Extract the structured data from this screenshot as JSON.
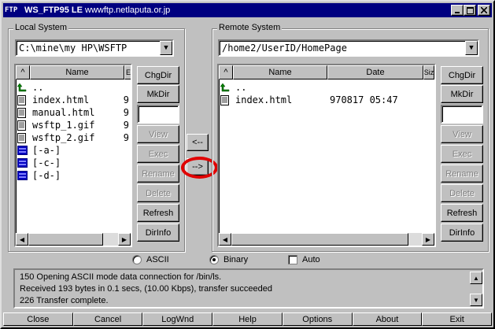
{
  "window": {
    "title_app": "WS_FTP95 LE",
    "title_host": "wwwftp.netlaputa.or.jp",
    "icon_text": "FTP"
  },
  "local": {
    "label": "Local System",
    "path": "C:\\mine\\my HP\\WSFTP",
    "col_up": "^",
    "col_name": "Name",
    "col_extra": "Ε",
    "files": [
      {
        "type": "up",
        "name": "..",
        "size": ""
      },
      {
        "type": "file",
        "name": "index.html",
        "size": "9"
      },
      {
        "type": "file",
        "name": "manual.html",
        "size": "9"
      },
      {
        "type": "file",
        "name": "wsftp_1.gif",
        "size": "9"
      },
      {
        "type": "file",
        "name": "wsftp_2.gif",
        "size": "9"
      },
      {
        "type": "drive",
        "name": "[-a-]",
        "size": ""
      },
      {
        "type": "drive",
        "name": "[-c-]",
        "size": ""
      },
      {
        "type": "drive",
        "name": "[-d-]",
        "size": ""
      }
    ],
    "buttons": {
      "chgdir": "ChgDir",
      "mkdir": "MkDir",
      "view": "View",
      "exec": "Exec",
      "rename": "Rename",
      "delete": "Delete",
      "refresh": "Refresh",
      "dirinfo": "DirInfo"
    }
  },
  "remote": {
    "label": "Remote System",
    "path": "/home2/UserID/HomePage",
    "col_up": "^",
    "col_name": "Name",
    "col_date": "Date",
    "col_size": "Siz",
    "files": [
      {
        "type": "up",
        "name": "..",
        "date": ""
      },
      {
        "type": "file",
        "name": "index.html",
        "date": "970817 05:47"
      }
    ],
    "buttons": {
      "chgdir": "ChgDir",
      "mkdir": "MkDir",
      "view": "View",
      "exec": "Exec",
      "rename": "Rename",
      "delete": "Delete",
      "refresh": "Refresh",
      "dirinfo": "DirInfo"
    }
  },
  "transfer": {
    "to_local": "<--",
    "to_remote": "-->"
  },
  "mode": {
    "ascii": "ASCII",
    "binary": "Binary",
    "auto": "Auto",
    "selected": "binary"
  },
  "log": [
    "150 Opening ASCII mode data connection for /bin/ls.",
    "Received 193 bytes in 0.1 secs, (10.00 Kbps), transfer succeeded",
    "226 Transfer complete."
  ],
  "bottom": {
    "close": "Close",
    "cancel": "Cancel",
    "logwnd": "LogWnd",
    "help": "Help",
    "options": "Options",
    "about": "About",
    "exit": "Exit"
  },
  "colors": {
    "titlebar": "#000080",
    "face": "#c0c0c0",
    "highlight_circle": "#e00000"
  }
}
